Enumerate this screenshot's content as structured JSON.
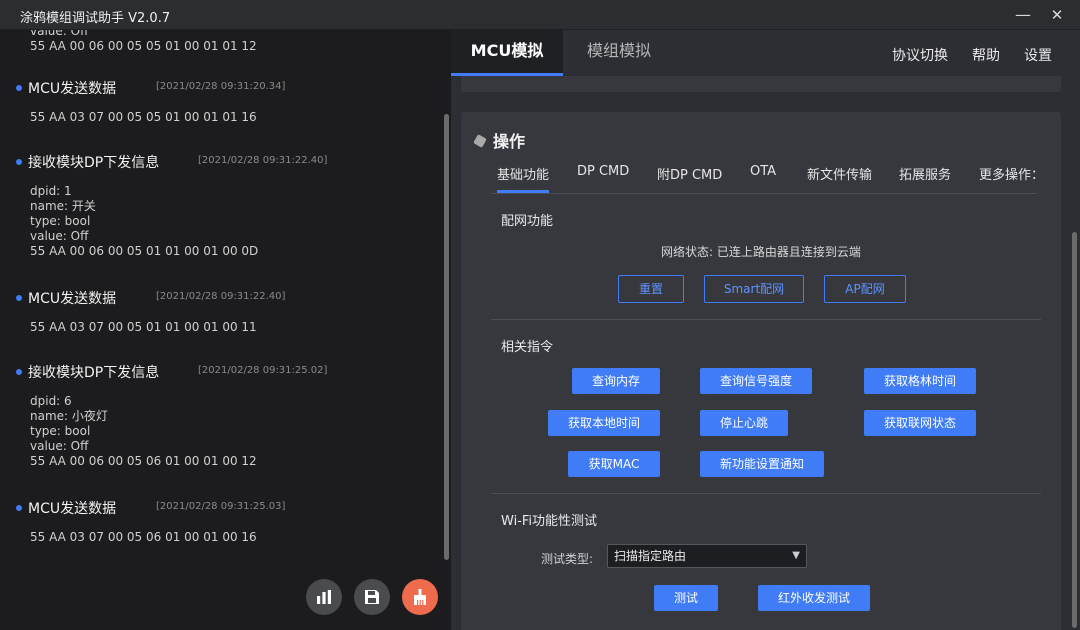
{
  "window": {
    "title": "涂鸦模组调试助手 V2.0.7",
    "minimize": "—",
    "close": "✕"
  },
  "log": {
    "partial_top": {
      "line_a": "value: Off",
      "line_b": "55 AA 00 06 00 05 05 01 00 01 01 12"
    },
    "entries": [
      {
        "title": "MCU发送数据",
        "timestamp": "[2021/02/28 09:31:20.34]",
        "lines": [
          "55 AA 03 07 00 05 05 01 00 01 01 16"
        ]
      },
      {
        "title": "接收模块DP下发信息",
        "timestamp": "[2021/02/28 09:31:22.40]",
        "lines": [
          "dpid: 1",
          "name: 开关",
          "type: bool",
          "value: Off",
          "55 AA 00 06 00 05 01 01 00 01 00 0D"
        ]
      },
      {
        "title": "MCU发送数据",
        "timestamp": "[2021/02/28 09:31:22.40]",
        "lines": [
          "55 AA 03 07 00 05 01 01 00 01 00 11"
        ]
      },
      {
        "title": "接收模块DP下发信息",
        "timestamp": "[2021/02/28 09:31:25.02]",
        "lines": [
          "dpid: 6",
          "name: 小夜灯",
          "type: bool",
          "value: Off",
          "55 AA 00 06 00 05 06 01 00 01 00 12"
        ]
      },
      {
        "title": "MCU发送数据",
        "timestamp": "[2021/02/28 09:31:25.03]",
        "lines": [
          "55 AA 03 07 00 05 06 01 00 01 00 16"
        ]
      }
    ],
    "actions": {
      "chart_icon": "bar-chart-icon",
      "save_icon": "save-icon",
      "clear_icon": "broom-icon"
    }
  },
  "nav": {
    "tabs": [
      "MCU模拟",
      "模组模拟"
    ],
    "links": [
      "协议切换",
      "帮助",
      "设置"
    ]
  },
  "operations": {
    "title": "操作",
    "subtabs": [
      "基础功能",
      "DP CMD",
      "附DP CMD",
      "OTA",
      "新文件传输",
      "拓展服务",
      "更多操作："
    ],
    "network": {
      "label": "配网功能",
      "status_label": "网络状态:",
      "status_value": "已连上路由器且连接到云端",
      "buttons": [
        "重置",
        "Smart配网",
        "AP配网"
      ]
    },
    "commands": {
      "label": "相关指令",
      "buttons": [
        "查询内存",
        "查询信号强度",
        "获取格林时间",
        "获取本地时间",
        "停止心跳",
        "获取联网状态",
        "获取MAC",
        "新功能设置通知"
      ]
    },
    "wifi_test": {
      "label": "Wi-Fi功能性测试",
      "type_label": "测试类型:",
      "type_value": "扫描指定路由",
      "buttons": [
        "测试",
        "红外收发测试"
      ]
    }
  },
  "colors": {
    "accent": "#3f7cf5",
    "clear_button": "#ee6c4d"
  }
}
